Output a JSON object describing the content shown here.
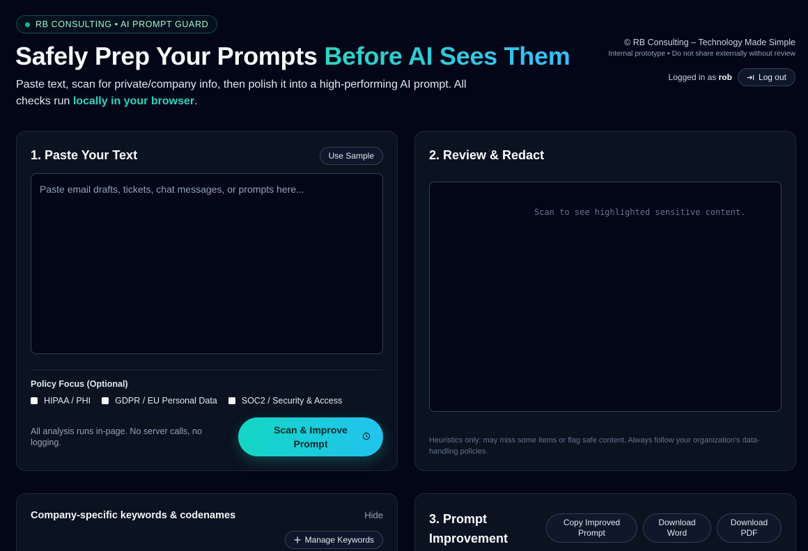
{
  "header": {
    "badge": "RB CONSULTING • AI PROMPT GUARD",
    "title_main": "Safely Prep Your Prompts ",
    "title_accent": "Before AI Sees Them",
    "subtitle_pre": "Paste text, scan for private/company info, then polish it into a high-performing AI prompt. All checks run ",
    "subtitle_highlight": "locally in your browser",
    "subtitle_post": ".",
    "copyright": "© RB Consulting – Technology Made Simple",
    "note": "Internal prototype • Do not share externally without review",
    "logged_in_prefix": "Logged in as ",
    "username": "rob",
    "logout_label": "Log out"
  },
  "paste_panel": {
    "title": "1. Paste Your Text",
    "sample_label": "Use Sample",
    "placeholder": "Paste email drafts, tickets, chat messages, or prompts here...",
    "policy_label": "Policy Focus (Optional)",
    "policies": [
      "HIPAA / PHI",
      "GDPR / EU Personal Data",
      "SOC2 / Security & Access"
    ],
    "runs_note": "All analysis runs in-page. No server calls, no logging.",
    "scan_label": "Scan & Improve Prompt"
  },
  "review_panel": {
    "title": "2. Review & Redact",
    "empty_text": "Scan to see highlighted sensitive content.",
    "heuristics_note": "Heuristics only: may miss some items or flag safe content. Always follow your organization's data-handling policies."
  },
  "keywords_panel": {
    "title": "Company-specific keywords & codenames",
    "hide_label": "Hide",
    "manage_label": "Manage Keywords"
  },
  "improvement_panel": {
    "title": "3. Prompt Improvement",
    "copy_label": "Copy Improved Prompt",
    "word_label": "Download Word",
    "pdf_label": "Download PDF"
  },
  "colors": {
    "background": "#020617",
    "accent": "#2dd4bf",
    "accent_blue": "#38bdf8",
    "status_dot": "#10b981"
  }
}
